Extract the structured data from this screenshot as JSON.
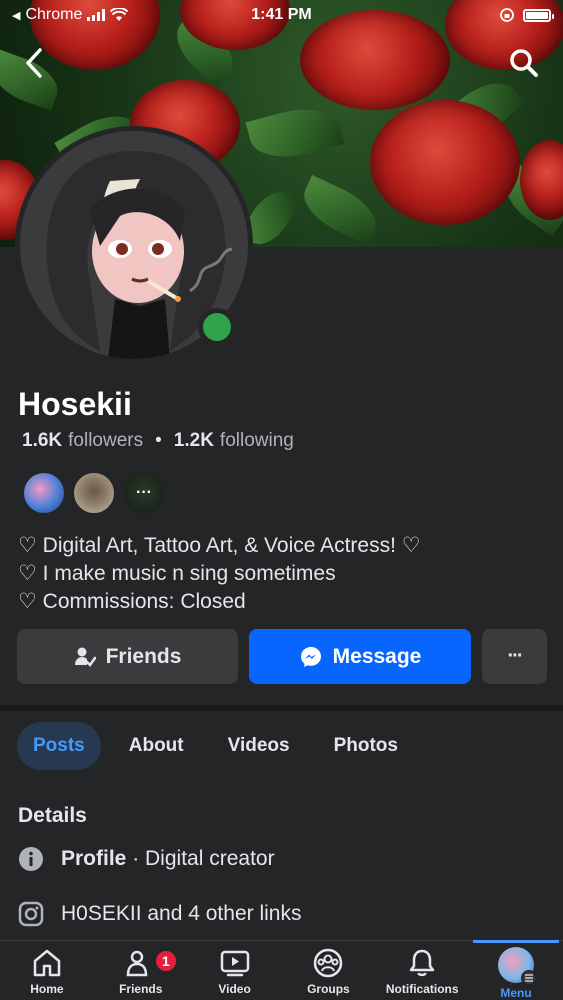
{
  "status_bar": {
    "back_app": "Chrome",
    "time": "1:41 PM"
  },
  "profile": {
    "name": "Hosekii",
    "followers_count": "1.6K",
    "followers_label": "followers",
    "following_count": "1.2K",
    "following_label": "following",
    "separator": "•",
    "bio": [
      "♡ Digital Art, Tattoo Art, & Voice Actress! ♡",
      "♡ I make music n sing sometimes",
      "♡ Commissions: Closed"
    ]
  },
  "actions": {
    "friends_label": "Friends",
    "message_label": "Message",
    "more_label": "···"
  },
  "tabs": [
    {
      "label": "Posts",
      "active": true
    },
    {
      "label": "About",
      "active": false
    },
    {
      "label": "Videos",
      "active": false
    },
    {
      "label": "Photos",
      "active": false
    }
  ],
  "details": {
    "title": "Details",
    "profile_bold": "Profile",
    "profile_rest": " · Digital creator",
    "links": "H0SEKII and 4 other links"
  },
  "bottom_nav": [
    {
      "label": "Home",
      "icon": "home-icon"
    },
    {
      "label": "Friends",
      "icon": "friends-icon",
      "badge": "1"
    },
    {
      "label": "Video",
      "icon": "video-icon"
    },
    {
      "label": "Groups",
      "icon": "groups-icon"
    },
    {
      "label": "Notifications",
      "icon": "bell-icon"
    },
    {
      "label": "Menu",
      "icon": "menu-avatar",
      "active": true
    }
  ],
  "colors": {
    "background": "#242526",
    "accent": "#0866ff",
    "active_tab": "#4599ff",
    "online": "#31a24c",
    "badge": "#e41e3f"
  }
}
